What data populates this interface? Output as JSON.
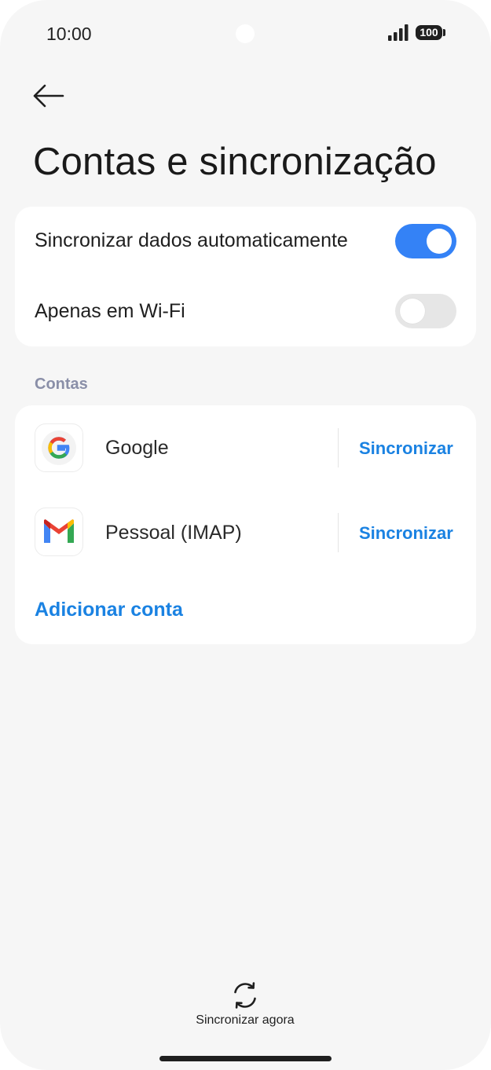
{
  "status_bar": {
    "time": "10:00",
    "battery": "100"
  },
  "header": {
    "title": "Contas e sincronização"
  },
  "sync_settings": {
    "auto_sync": {
      "label": "Sincronizar dados automaticamente",
      "enabled": true
    },
    "wifi_only": {
      "label": "Apenas em Wi-Fi",
      "enabled": false
    }
  },
  "accounts_section": {
    "header": "Contas",
    "items": [
      {
        "name": "Google",
        "icon": "google-icon",
        "sync_label": "Sincronizar"
      },
      {
        "name": "Pessoal (IMAP)",
        "icon": "gmail-icon",
        "sync_label": "Sincronizar"
      }
    ],
    "add_account": "Adicionar conta"
  },
  "footer": {
    "sync_now_label": "Sincronizar agora",
    "sync_now_icon": "sync-icon"
  },
  "colors": {
    "accent": "#3482f6",
    "link": "#1a82e2",
    "background": "#f6f6f6",
    "section_header": "#8a8fa8"
  }
}
